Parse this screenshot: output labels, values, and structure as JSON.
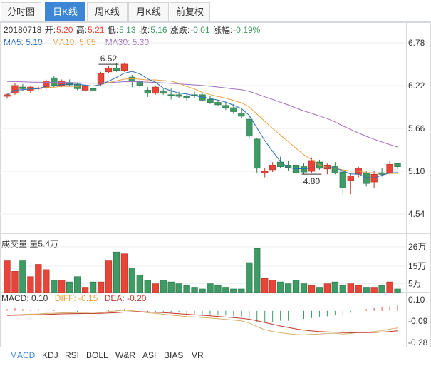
{
  "tabs": [
    "分时图",
    "日K线",
    "周K线",
    "月K线",
    "前复权"
  ],
  "active_tab": 1,
  "info": {
    "date": "20180718",
    "open_label": "开:",
    "open": "5.20",
    "high_label": "高:",
    "high": "5.21",
    "low_label": "低:",
    "low": "5.13",
    "close_label": "收:",
    "close": "5.16",
    "change_label": "涨跌:",
    "change": "-0.01",
    "pct_label": "涨幅:",
    "pct": "-0.19%"
  },
  "ma": {
    "ma5": "MA5: 5.10",
    "ma10": "MA10: 5.05",
    "ma30": "MA30: 5.30"
  },
  "volume_label": "成交量 量5.4万",
  "macd": {
    "macd": "MACD: 0.10",
    "diff": "DIFF: -0.15",
    "dea": "DEA: -0.20"
  },
  "indicator_tabs": [
    "MACD",
    "KDJ",
    "RSI",
    "BOLL",
    "W&R",
    "ASI",
    "BIAS",
    "VR"
  ],
  "active_indicator": 0,
  "colors": {
    "up": "#e8443a",
    "down": "#3f9a65",
    "ma5": "#2a6cb3",
    "ma10": "#e8a040",
    "ma30": "#a070c0",
    "accent": "#3d86d6"
  },
  "chart_data": [
    {
      "type": "candlestick",
      "price_axis_ticks": [
        "6.78",
        "6.22",
        "5.66",
        "5.10",
        "4.54"
      ],
      "ylim": [
        4.54,
        6.78
      ],
      "annotations": [
        {
          "text": "6.52",
          "candle": 13
        },
        {
          "text": "4.80",
          "candle": 39
        }
      ],
      "candles": [
        [
          6.08,
          6.12,
          6.05,
          6.1
        ],
        [
          6.12,
          6.25,
          6.1,
          6.22
        ],
        [
          6.2,
          6.24,
          6.15,
          6.18
        ],
        [
          6.15,
          6.22,
          6.12,
          6.2
        ],
        [
          6.18,
          6.22,
          6.16,
          6.19
        ],
        [
          6.2,
          6.3,
          6.17,
          6.28
        ],
        [
          6.32,
          6.34,
          6.2,
          6.22
        ],
        [
          6.22,
          6.3,
          6.2,
          6.28
        ],
        [
          6.26,
          6.3,
          6.21,
          6.23
        ],
        [
          6.24,
          6.26,
          6.16,
          6.18
        ],
        [
          6.16,
          6.24,
          6.14,
          6.22
        ],
        [
          6.18,
          6.25,
          6.14,
          6.16
        ],
        [
          6.24,
          6.4,
          6.22,
          6.38
        ],
        [
          6.4,
          6.48,
          6.38,
          6.45
        ],
        [
          6.45,
          6.52,
          6.4,
          6.42
        ],
        [
          6.42,
          6.52,
          6.4,
          6.5
        ],
        [
          6.33,
          6.36,
          6.2,
          6.28
        ],
        [
          6.28,
          6.3,
          6.18,
          6.22
        ],
        [
          6.16,
          6.2,
          6.07,
          6.12
        ],
        [
          6.12,
          6.22,
          6.1,
          6.2
        ],
        [
          6.14,
          6.18,
          6.1,
          6.12
        ],
        [
          6.1,
          6.18,
          6.04,
          6.09
        ],
        [
          6.1,
          6.14,
          6.06,
          6.08
        ],
        [
          6.08,
          6.1,
          6.02,
          6.06
        ],
        [
          6.1,
          6.14,
          6.06,
          6.09
        ],
        [
          6.1,
          6.12,
          6.01,
          6.03
        ],
        [
          6.04,
          6.08,
          5.98,
          6.0
        ],
        [
          6.0,
          6.02,
          5.95,
          5.97
        ],
        [
          5.96,
          6.0,
          5.9,
          5.93
        ],
        [
          5.93,
          5.98,
          5.85,
          5.88
        ],
        [
          5.86,
          5.92,
          5.8,
          5.82
        ],
        [
          5.78,
          5.82,
          5.52,
          5.56
        ],
        [
          5.52,
          5.53,
          5.08,
          5.14
        ],
        [
          5.08,
          5.14,
          5.02,
          5.1
        ],
        [
          5.12,
          5.22,
          5.09,
          5.18
        ],
        [
          5.22,
          5.29,
          5.14,
          5.16
        ],
        [
          5.18,
          5.24,
          5.1,
          5.15
        ],
        [
          5.18,
          5.21,
          5.06,
          5.08
        ],
        [
          5.16,
          5.2,
          5.06,
          5.09
        ],
        [
          5.1,
          5.28,
          5.08,
          5.24
        ],
        [
          5.22,
          5.25,
          5.12,
          5.14
        ],
        [
          5.13,
          5.2,
          5.06,
          5.18
        ],
        [
          5.16,
          5.22,
          5.06,
          5.08
        ],
        [
          5.09,
          5.1,
          4.8,
          4.88
        ],
        [
          4.98,
          5.08,
          4.8,
          5.04
        ],
        [
          5.06,
          5.16,
          5.02,
          5.14
        ],
        [
          5.08,
          5.11,
          4.9,
          4.94
        ],
        [
          4.96,
          5.1,
          4.88,
          5.06
        ],
        [
          5.08,
          5.14,
          5.03,
          5.06
        ],
        [
          5.08,
          5.24,
          5.06,
          5.19
        ],
        [
          5.2,
          5.21,
          5.13,
          5.16
        ]
      ]
    },
    {
      "type": "bar",
      "title": "成交量",
      "ticks": [
        "26万",
        "15万",
        "5万"
      ],
      "ylim": [
        0,
        28
      ],
      "values": [
        18,
        12,
        18,
        9,
        16,
        13,
        7,
        7,
        6,
        9,
        3,
        6,
        6,
        18,
        23,
        22,
        14,
        10,
        7,
        5,
        7,
        6,
        5,
        4,
        3,
        2,
        5,
        4,
        3,
        2,
        2,
        17,
        25,
        8,
        7,
        6,
        5,
        7,
        5,
        4,
        3,
        5,
        6,
        4,
        5,
        4,
        3,
        3,
        4,
        6,
        2
      ]
    },
    {
      "type": "bar",
      "title": "MACD",
      "ticks": [
        "0.10",
        "-0.09",
        "-0.28"
      ],
      "ylim": [
        -0.28,
        0.1
      ],
      "values": [
        0.01,
        0.015,
        0.01,
        0.005,
        0.01,
        0.005,
        0.005,
        0.0,
        0.0,
        -0.005,
        -0.005,
        -0.01,
        0.0,
        0.005,
        0.005,
        0.01,
        0.0,
        -0.005,
        -0.005,
        -0.01,
        -0.01,
        -0.01,
        -0.01,
        -0.015,
        -0.015,
        -0.02,
        -0.02,
        -0.025,
        -0.025,
        -0.03,
        -0.03,
        -0.04,
        -0.06,
        -0.065,
        -0.06,
        -0.055,
        -0.055,
        -0.05,
        -0.045,
        -0.04,
        -0.035,
        -0.03,
        -0.025,
        -0.02,
        -0.01,
        0.0,
        0.01,
        0.015,
        0.02,
        0.025,
        0.03
      ]
    }
  ]
}
